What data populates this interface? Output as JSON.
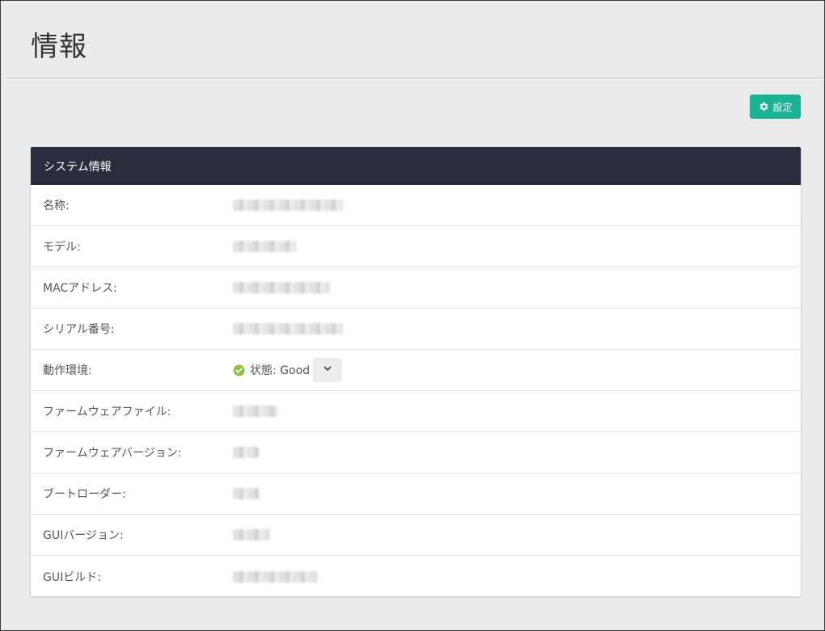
{
  "page": {
    "title": "情報"
  },
  "toolbar": {
    "settings_label": "設定",
    "settings_icon": "gear-icon"
  },
  "panel": {
    "header": "システム情報",
    "rows": [
      {
        "label": "名称:",
        "value_redacted": true
      },
      {
        "label": "モデル:",
        "value_redacted": true
      },
      {
        "label": "MACアドレス:",
        "value_redacted": true
      },
      {
        "label": "シリアル番号:",
        "value_redacted": true
      },
      {
        "label": "動作環境:",
        "status_text": "状態: Good",
        "status_icon": "check-circle-icon",
        "status_color": "#8cc34a"
      },
      {
        "label": "ファームウェアファイル:",
        "value_redacted": true
      },
      {
        "label": "ファームウェアバージョン:",
        "value_redacted": true
      },
      {
        "label": "ブートローダー:",
        "value_redacted": true
      },
      {
        "label": "GUIバージョン:",
        "value_redacted": true
      },
      {
        "label": "GUIビルド:",
        "value_redacted": true
      }
    ]
  },
  "colors": {
    "accent": "#1ab394",
    "header_bg": "#2a2d3c",
    "background": "#ebebeb"
  }
}
